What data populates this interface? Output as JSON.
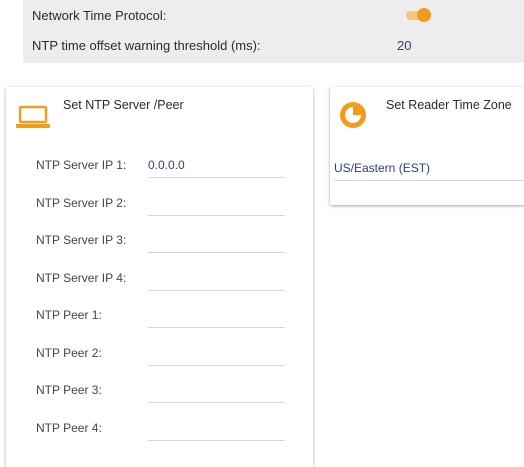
{
  "settings": {
    "ntp_label": "Network Time Protocol:",
    "ntp_enabled": true,
    "threshold_label": "NTP time offset warning threshold (ms):",
    "threshold_value": "20"
  },
  "ntp_panel": {
    "title": "Set NTP Server /Peer",
    "icon": "laptop-icon",
    "fields": [
      {
        "label": "NTP Server IP 1:",
        "value": "0.0.0.0"
      },
      {
        "label": "NTP Server IP 2:",
        "value": ""
      },
      {
        "label": "NTP Server IP 3:",
        "value": ""
      },
      {
        "label": "NTP Server IP 4:",
        "value": ""
      },
      {
        "label": "NTP Peer 1:",
        "value": ""
      },
      {
        "label": "NTP Peer 2:",
        "value": ""
      },
      {
        "label": "NTP Peer 3:",
        "value": ""
      },
      {
        "label": "NTP Peer 4:",
        "value": ""
      }
    ]
  },
  "timezone_panel": {
    "title": "Set Reader Time Zone",
    "icon": "clock-icon",
    "value": "US/Eastern (EST)"
  },
  "colors": {
    "accent": "#f39c1c",
    "value_text": "#2c3e8c",
    "strip_background": "#ededed"
  }
}
